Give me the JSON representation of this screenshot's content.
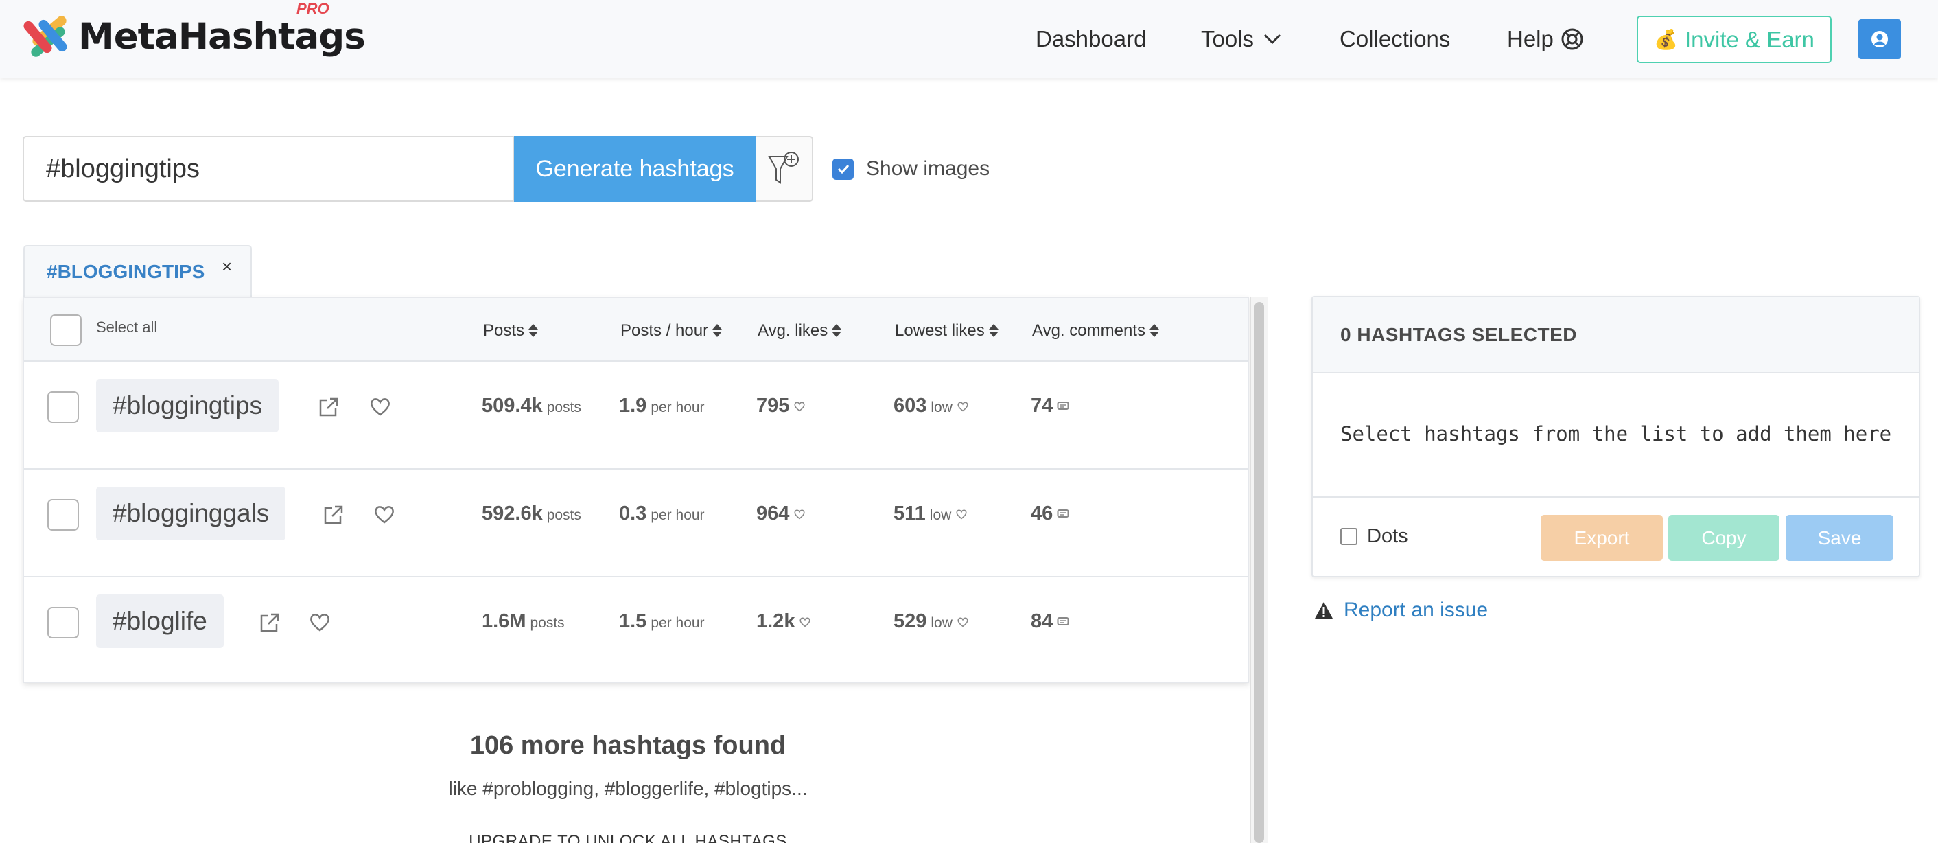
{
  "header": {
    "brand": "MetaHashtags",
    "badge": "PRO",
    "nav": [
      "Dashboard",
      "Tools",
      "Collections",
      "Help"
    ],
    "invite": "Invite & Earn"
  },
  "search": {
    "value": "#bloggingtips",
    "button": "Generate hashtags",
    "show_images": "Show images"
  },
  "tab": {
    "label": "#BLOGGINGTIPS",
    "close": "×"
  },
  "table": {
    "select_all": "Select all",
    "columns": [
      "Posts",
      "Posts / hour",
      "Avg. likes",
      "Lowest likes",
      "Avg. comments"
    ],
    "rows": [
      {
        "tag": "#bloggingtips",
        "posts": "509.4k",
        "posts_unit": "posts",
        "per_hour": "1.9",
        "per_hour_unit": "per hour",
        "avg_likes": "795",
        "lowest": "603",
        "lowest_unit": "low",
        "comments": "74"
      },
      {
        "tag": "#blogginggals",
        "posts": "592.6k",
        "posts_unit": "posts",
        "per_hour": "0.3",
        "per_hour_unit": "per hour",
        "avg_likes": "964",
        "lowest": "511",
        "lowest_unit": "low",
        "comments": "46"
      },
      {
        "tag": "#bloglife",
        "posts": "1.6M",
        "posts_unit": "posts",
        "per_hour": "1.5",
        "per_hour_unit": "per hour",
        "avg_likes": "1.2k",
        "lowest": "529",
        "lowest_unit": "low",
        "comments": "84"
      }
    ]
  },
  "more": {
    "title": "106 more hashtags found",
    "like": "like #problogging, #bloggerlife, #blogtips...",
    "upgrade": "UPGRADE TO UNLOCK ALL HASHTAGS"
  },
  "panel": {
    "title": "0 HASHTAGS SELECTED",
    "empty": "Select hashtags from the list to add them here",
    "dots": "Dots",
    "export": "Export",
    "copy": "Copy",
    "save": "Save"
  },
  "report": "Report an issue",
  "colors": {
    "accent": "#4aa3e6",
    "export": "#f6cfa6",
    "copy": "#a3e6d1",
    "save": "#9ccbf3",
    "invite": "#3ec6a4"
  }
}
